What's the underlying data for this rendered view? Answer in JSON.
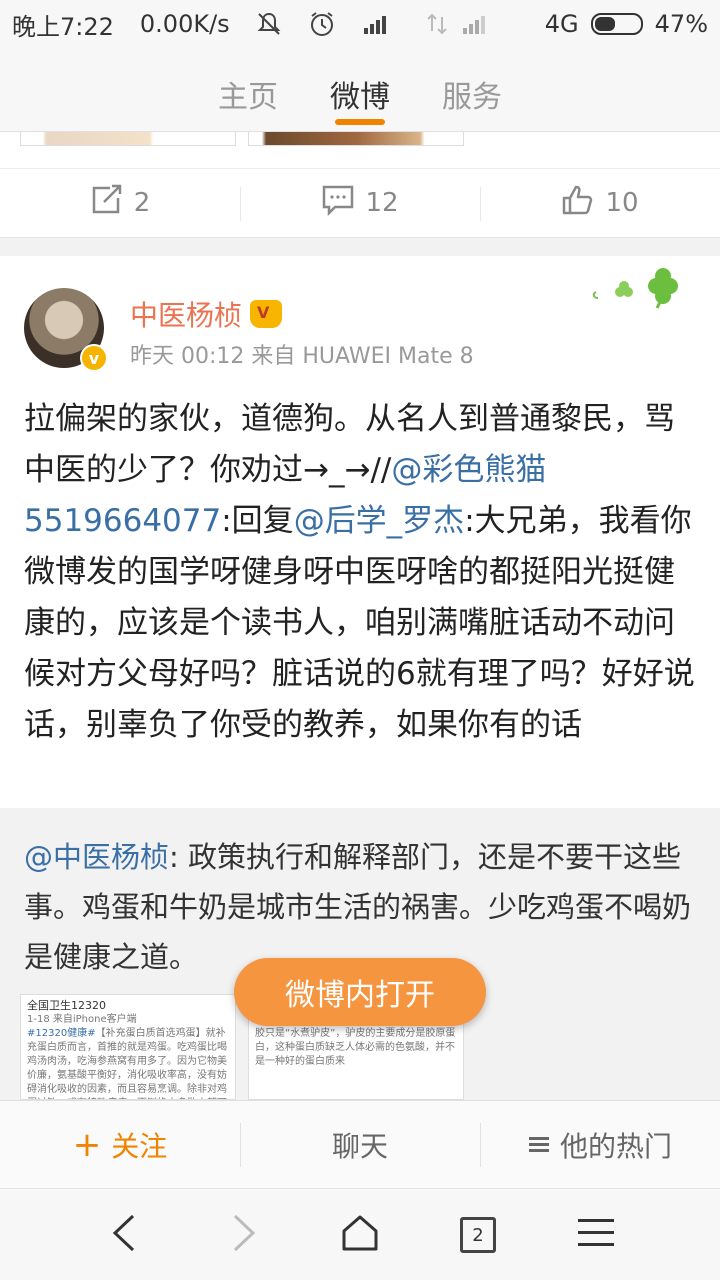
{
  "status_bar": {
    "time": "晚上7:22",
    "net_speed": "0.00K/s",
    "network": "4G",
    "battery": "47%",
    "battery_level": 0.47
  },
  "tabs": [
    {
      "label": "主页",
      "active": false
    },
    {
      "label": "微博",
      "active": true
    },
    {
      "label": "服务",
      "active": false
    }
  ],
  "prev_post_actions": {
    "repost_count": "2",
    "comment_count": "12",
    "like_count": "10"
  },
  "post": {
    "username": "中医杨桢",
    "meta": "昨天 00:12 来自 HUAWEI Mate 8",
    "verified_badge": "v",
    "text_1": "拉偏架的家伙，道德狗。从名人到普通黎民，骂中医的少了？你劝过→_→//",
    "mention_1": "@彩色熊猫5519664077",
    "text_2": ":回复",
    "mention_2": "@后学_罗杰",
    "text_3": ":大兄弟，我看你微博发的国学呀健身呀中医呀啥的都挺阳光挺健康的，应该是个读书人，咱别满嘴脏话动不动问候对方父母好吗？脏话说的6就有理了吗？好好说话，别辜负了你受的教养，如果你有的话"
  },
  "retweet": {
    "mention": "@中医杨桢",
    "text": ": 政策执行和解释部门，还是不要干这些事。鸡蛋和牛奶是城市生活的祸害。少吃鸡蛋不喝奶是健康之道。",
    "img1_header": "全国卫生12320",
    "img1_sub": "1-18  来自iPhone客户端",
    "img1_tag": "#12320健康#",
    "img1_body": "【补充蛋白质首选鸡蛋】就补充蛋白质而言，首推的就是鸡蛋。吃鸡蛋比喝鸡汤肉汤，吃海参燕窝有用多了。因为它物美价廉，氨基酸平衡好，消化吸收率高，没有妨碍消化吸收的因素，而且容易烹调。除非对鸡蛋过敏，或有特殊疾病，否则绝大多数人都可以",
    "img2_body": "效的光环加持：补血、止血、养颜、安胎、抗疲劳、抗癌……不过，请透过现象看本质，阿胶只是“水煮驴皮”，驴皮的主要成分是胶原蛋白，这种蛋白质缺乏人体必需的色氨酸，并不是一种好的蛋白质来"
  },
  "open_in_weibo": "微博内打开",
  "bottom_actions": {
    "follow": "关注",
    "chat": "聊天",
    "hot": "他的热门"
  },
  "nav": {
    "tab_count": "2"
  },
  "colors": {
    "accent": "#f08300",
    "username": "#eb7350",
    "link": "#3a6fa6"
  }
}
